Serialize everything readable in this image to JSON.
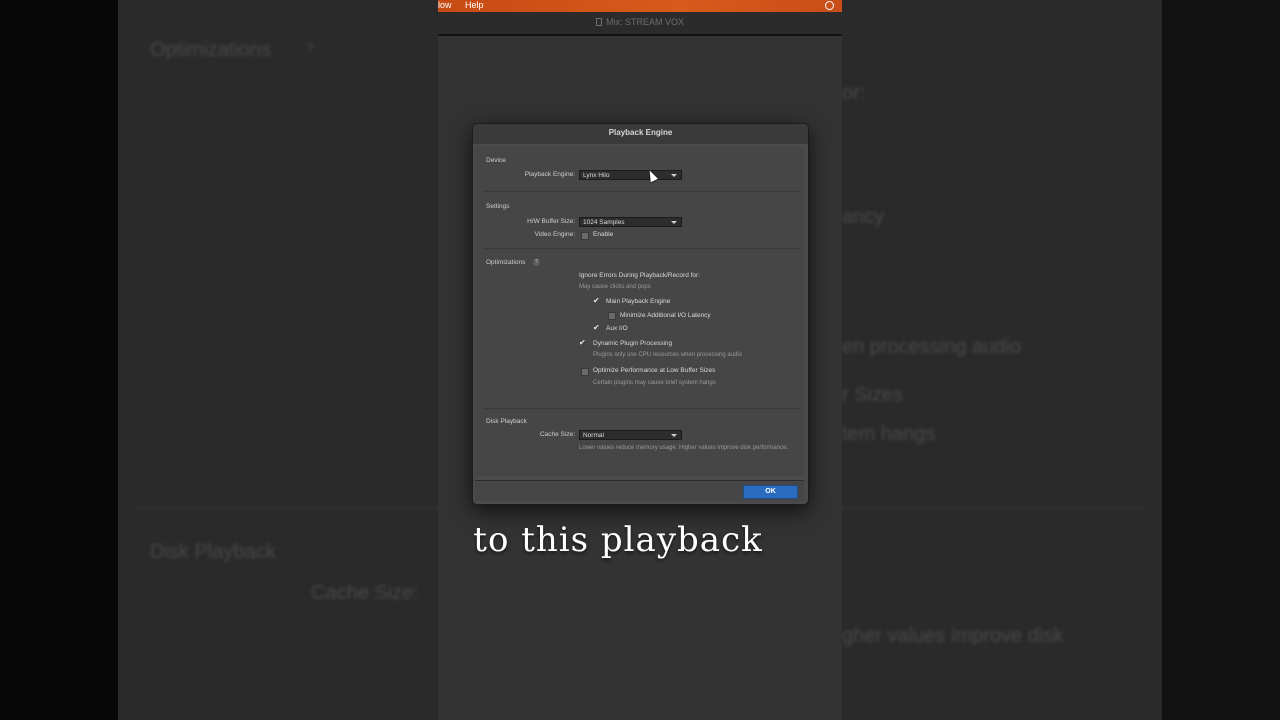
{
  "menubar": {
    "item1": "low",
    "item2": "Help"
  },
  "mix_window": {
    "title": "Mix: STREAM VOX"
  },
  "background": {
    "optimizations": "Optimizations",
    "help_mark": "?",
    "for_fragment": "or:",
    "latency_fragment": "ancy",
    "processing_fragment": "en processing audio",
    "sizes_fragment": "r Sizes",
    "hangs_fragment": "tem hangs",
    "disk_playback": "Disk Playback",
    "cache_size": "Cache Size:",
    "improve_fragment": "gher values improve disk"
  },
  "dialog": {
    "title": "Playback Engine",
    "device": {
      "section": "Device",
      "engine_label": "Playback Engine:",
      "engine_value": "Lynx Hilo"
    },
    "settings": {
      "section": "Settings",
      "buffer_label": "H/W Buffer Size:",
      "buffer_value": "1024 Samples",
      "video_label": "Video Engine:",
      "video_enable": "Enable",
      "video_checked": false
    },
    "optimizations": {
      "section": "Optimizations",
      "help": "?",
      "ignore_errors": "Ignore Errors During Playback/Record for:",
      "ignore_hint": "May cause clicks and pops",
      "main_engine": "Main Playback Engine",
      "main_engine_checked": true,
      "minimize_latency": "Minimize Additional I/O Latency",
      "minimize_latency_checked": false,
      "aux_io": "Aux I/O",
      "aux_io_checked": true,
      "dynamic_plugin": "Dynamic Plugin Processing",
      "dynamic_plugin_checked": true,
      "dynamic_hint": "Plugins only use CPU resources when processing audio",
      "optimize_low_buffer": "Optimize Performance at Low Buffer Sizes",
      "optimize_low_buffer_checked": false,
      "optimize_hint": "Certain plugins may cause brief system hangs"
    },
    "disk": {
      "section": "Disk Playback",
      "cache_label": "Cache Size:",
      "cache_value": "Normal",
      "cache_hint": "Lower values reduce memory usage. Higher values improve disk performance."
    },
    "ok_label": "OK"
  },
  "caption": "to this playback",
  "colors": {
    "menubar": "#d1531a",
    "ok_button": "#2b6cbf",
    "dialog_bg": "#4b4b4b"
  }
}
